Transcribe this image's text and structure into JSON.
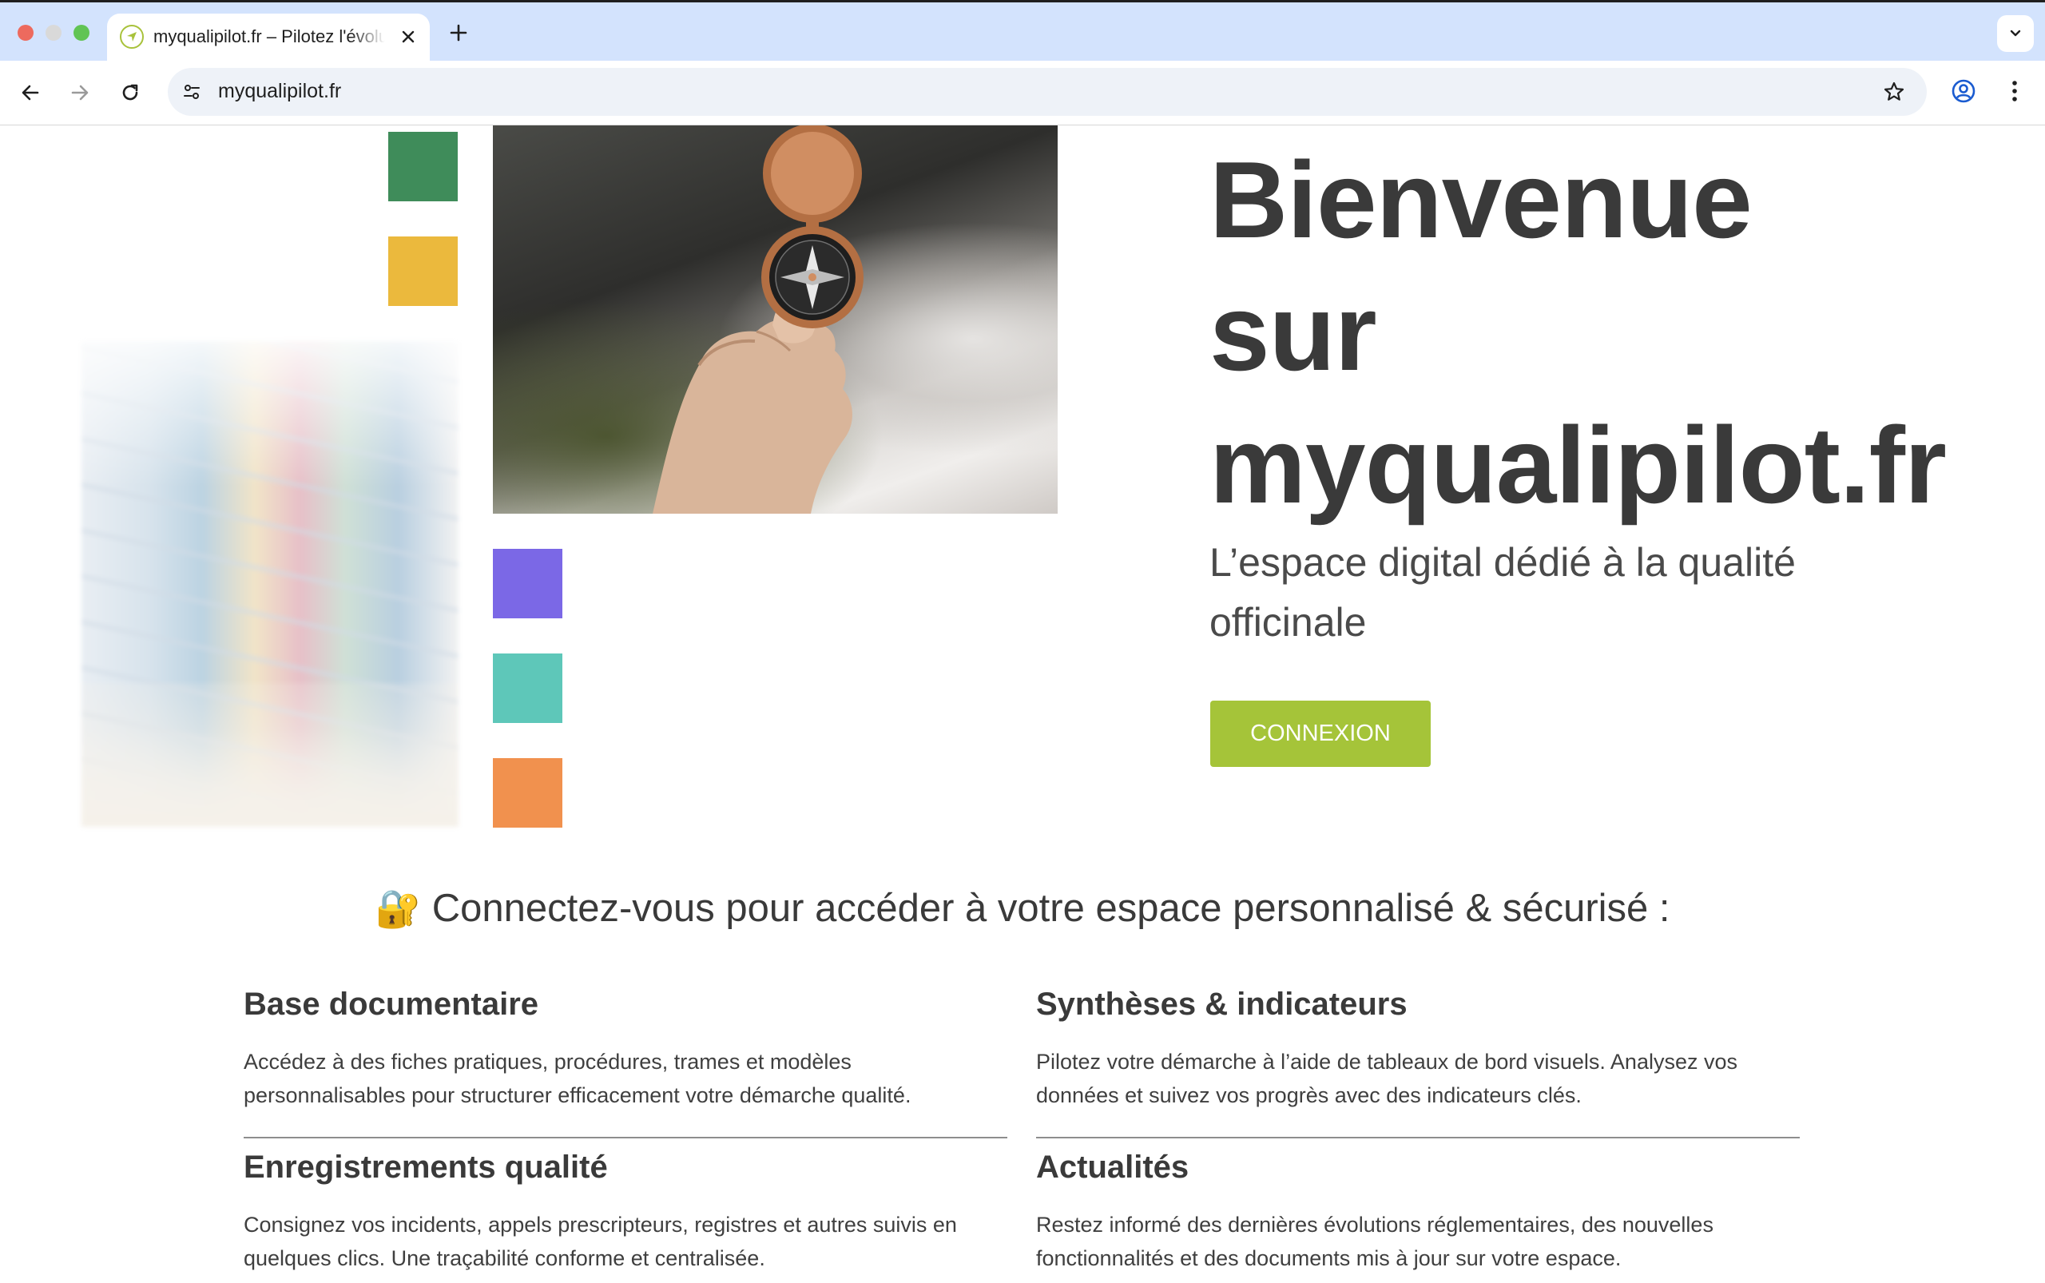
{
  "browser": {
    "tab_title": "myqualipilot.fr – Pilotez l'évolution",
    "url": "myqualipilot.fr"
  },
  "colors": {
    "accent_green": "#a5c439",
    "square_green": "#3f8c5a",
    "square_yellow": "#ebb93d",
    "square_purple": "#7b68e6",
    "square_teal": "#5ec7b9",
    "square_orange": "#f1914e",
    "text": "#3a3a3a"
  },
  "hero": {
    "title_line1": "Bienvenue",
    "title_line2": "sur",
    "title_line3": "myqualipilot.fr",
    "subtitle": "L’espace digital dédié à la qualité officinale",
    "cta_label": "CONNEXION"
  },
  "connect": {
    "lock_icon": "🔐",
    "text": "Connectez-vous pour accéder à votre espace personnalisé & sécurisé :"
  },
  "features": [
    {
      "title": "Base documentaire",
      "text": "Accédez à des fiches pratiques, procédures, trames et modèles personnalisables pour structurer efficacement votre démarche qualité."
    },
    {
      "title": "Synthèses & indicateurs",
      "text": "Pilotez votre démarche à l’aide de tableaux de bord visuels. Analysez vos données et suivez vos progrès avec des indicateurs clés."
    },
    {
      "title": "Enregistrements qualité",
      "text": "Consignez vos incidents, appels prescripteurs, registres et autres suivis en quelques clics. Une traçabilité conforme et centralisée."
    },
    {
      "title": "Actualités",
      "text": "Restez informé des dernières évolutions réglementaires, des nouvelles fonctionnalités et des documents mis à jour sur votre espace."
    }
  ]
}
